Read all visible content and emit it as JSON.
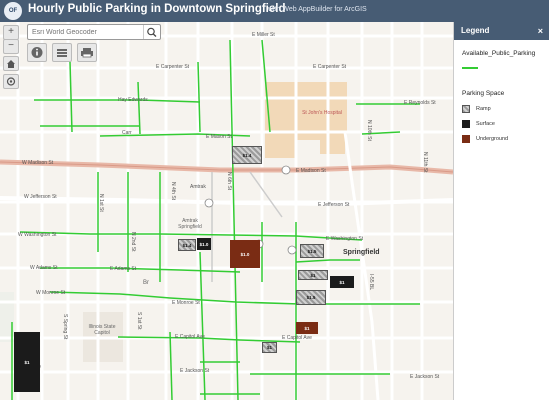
{
  "header": {
    "title": "Hourly Public Parking in Downtown Springfield",
    "subtitle": "with Web AppBuilder for ArcGIS",
    "logo_text": "OF"
  },
  "search": {
    "placeholder": "Esri World Geocoder"
  },
  "toolbar": {
    "zoom_in": "+",
    "zoom_out": "−",
    "home_icon": "home-icon",
    "locate_icon": "locate-icon",
    "info_icon": "info-icon",
    "layers_icon": "layers-icon",
    "print_icon": "print-icon"
  },
  "legend": {
    "title": "Legend",
    "close": "×",
    "layer1": "Available_Public_Parking",
    "layer1_color": "#33cc33",
    "layer2": "Parking Space",
    "items": [
      {
        "label": "Ramp",
        "color": "#9a9a9a"
      },
      {
        "label": "Surface",
        "color": "#1b1b1b"
      },
      {
        "label": "Underground",
        "color": "#7a2c14"
      }
    ]
  },
  "map": {
    "roads": {
      "miller": "E Miller St",
      "carpenter": "E Carpenter St",
      "reynolds": "E Reynolds St",
      "mason": "E Mason St",
      "madison": "E Madison St",
      "jefferson": "E Jefferson St",
      "washington": "E Washington St",
      "adams": "E Adams St",
      "monroe": "E Monroe St",
      "capitol": "E Capitol Ave",
      "jackson": "E Jackson St",
      "w_madison": "W Madison St",
      "w_jefferson": "W Jefferson St",
      "w_washington": "W Washington St",
      "w_adams": "W Adams St",
      "w_monroe": "W Monroe St",
      "n_1st": "N 1st St",
      "n_2nd": "N 2nd St",
      "n_4th": "N 4th St",
      "n_6th": "N 6th St",
      "n_11th": "N 11th St",
      "n_10th": "N 10th St",
      "s_spring": "S Spring St",
      "s_college": "S College St",
      "i55": "I-55 BL",
      "s_1st": "S 1st St",
      "hay": "Hay Edwards",
      "amtrak": "Amtrak",
      "carr": "Carr"
    },
    "places": {
      "city": "Springfield",
      "hospital": "St John's Hospital",
      "station": "Amtrak Springfield",
      "state_bldg": "Illinois State Capitol",
      "br": "Br"
    },
    "lots": [
      {
        "type": "ramp",
        "label": "$1.4"
      },
      {
        "type": "ramp",
        "label": "$1.4"
      },
      {
        "type": "surface",
        "label": "$1.0"
      },
      {
        "type": "underground",
        "label": "$1.0"
      },
      {
        "type": "ramp",
        "label": "$1.5"
      },
      {
        "type": "ramp",
        "label": "$1"
      },
      {
        "type": "surface",
        "label": "$1"
      },
      {
        "type": "ramp",
        "label": "$1.5"
      },
      {
        "type": "underground",
        "label": "$1"
      },
      {
        "type": "ramp",
        "label": "$1"
      },
      {
        "type": "surface",
        "label": "$1"
      }
    ]
  }
}
